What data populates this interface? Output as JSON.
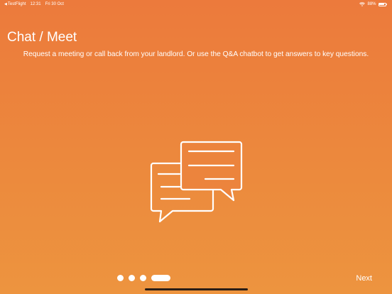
{
  "status_bar": {
    "back_app": "TestFlight",
    "time": "12:31",
    "date": "Fri 30 Oct",
    "battery": "88%",
    "battery_level": 0.88,
    "icons": [
      "back-caret",
      "wifi-icon",
      "battery-icon"
    ]
  },
  "onboarding": {
    "title": "Chat / Meet",
    "subtitle": "Request a meeting or call back from your landlord. Or use the Q&A chatbot to get answers to key questions.",
    "illustration_icon": "chat-bubbles-icon",
    "pager": {
      "total": 4,
      "active_index": 3
    },
    "next_label": "Next"
  },
  "colors": {
    "background_top": "#ec7a3c",
    "background_bottom": "#ed943f",
    "foreground": "#ffffff",
    "home_indicator": "#2a1d15"
  }
}
